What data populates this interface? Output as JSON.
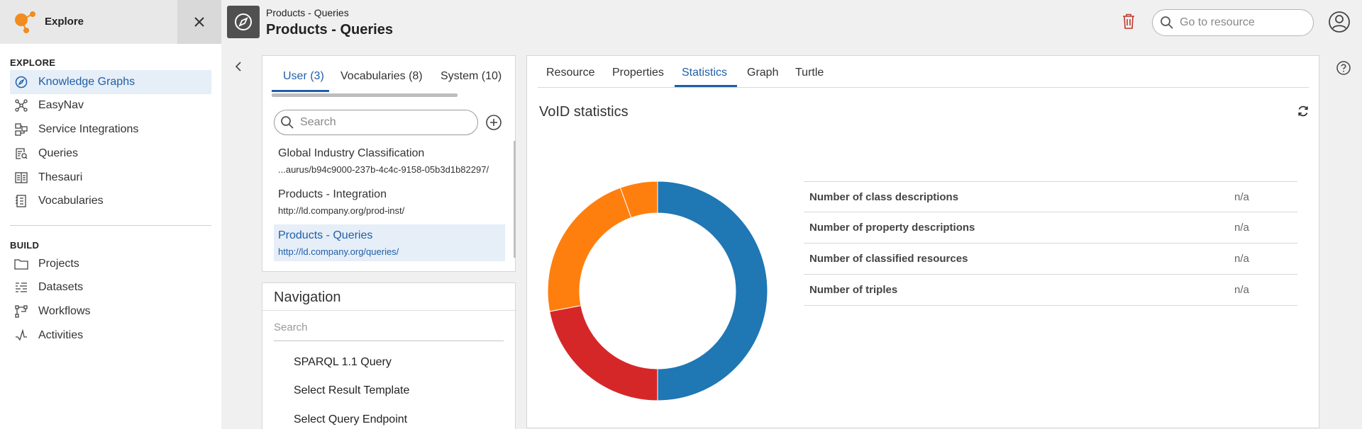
{
  "sidebar": {
    "app_name": "Explore",
    "sections": {
      "explore": "EXPLORE",
      "build": "BUILD"
    },
    "explore_items": [
      {
        "label": "Knowledge Graphs",
        "icon": "compass-icon",
        "active": true
      },
      {
        "label": "EasyNav",
        "icon": "graph-network-icon"
      },
      {
        "label": "Service Integrations",
        "icon": "integration-icon"
      },
      {
        "label": "Queries",
        "icon": "query-icon"
      },
      {
        "label": "Thesauri",
        "icon": "thesaurus-icon"
      },
      {
        "label": "Vocabularies",
        "icon": "vocabulary-icon"
      }
    ],
    "build_items": [
      {
        "label": "Projects",
        "icon": "folder-icon"
      },
      {
        "label": "Datasets",
        "icon": "dataset-icon"
      },
      {
        "label": "Workflows",
        "icon": "workflow-icon"
      },
      {
        "label": "Activities",
        "icon": "activity-icon"
      }
    ]
  },
  "header": {
    "breadcrumb": "Products - Queries",
    "title": "Products - Queries",
    "search_placeholder": "Go to resource"
  },
  "graph_list": {
    "tabs": [
      {
        "label": "User (3)",
        "active": true
      },
      {
        "label": "Vocabularies (8)"
      },
      {
        "label": "System (10)"
      }
    ],
    "search_placeholder": "Search",
    "items": [
      {
        "title": "Global Industry Classification",
        "uri": "...aurus/b94c9000-237b-4c4c-9158-05b3d1b82297/"
      },
      {
        "title": "Products - Integration",
        "uri": "http://ld.company.org/prod-inst/"
      },
      {
        "title": "Products - Queries",
        "uri": "http://ld.company.org/queries/",
        "active": true
      }
    ]
  },
  "navigation": {
    "title": "Navigation",
    "search_placeholder": "Search",
    "items": [
      "SPARQL 1.1 Query",
      "Select Result Template",
      "Select Query Endpoint"
    ]
  },
  "details": {
    "tabs": [
      {
        "label": "Resource"
      },
      {
        "label": "Properties"
      },
      {
        "label": "Statistics",
        "active": true
      },
      {
        "label": "Graph"
      },
      {
        "label": "Turtle"
      }
    ],
    "void_title": "VoID statistics",
    "stats": [
      {
        "label": "Number of class descriptions",
        "value": "n/a"
      },
      {
        "label": "Number of property descriptions",
        "value": "n/a"
      },
      {
        "label": "Number of classified resources",
        "value": "n/a"
      },
      {
        "label": "Number of triples",
        "value": "n/a"
      }
    ]
  },
  "donut_segments": [
    {
      "share": 0.5,
      "color": "#1f77b4"
    },
    {
      "share": 0.22,
      "color": "#d62728"
    },
    {
      "share": 0.225,
      "color": "#ff7f0e"
    },
    {
      "share": 0.055,
      "color": "#ff7f0e"
    }
  ],
  "colors": {
    "accent": "#1f5fa8",
    "logo": "#f28c1e",
    "delete": "#c0392b"
  }
}
